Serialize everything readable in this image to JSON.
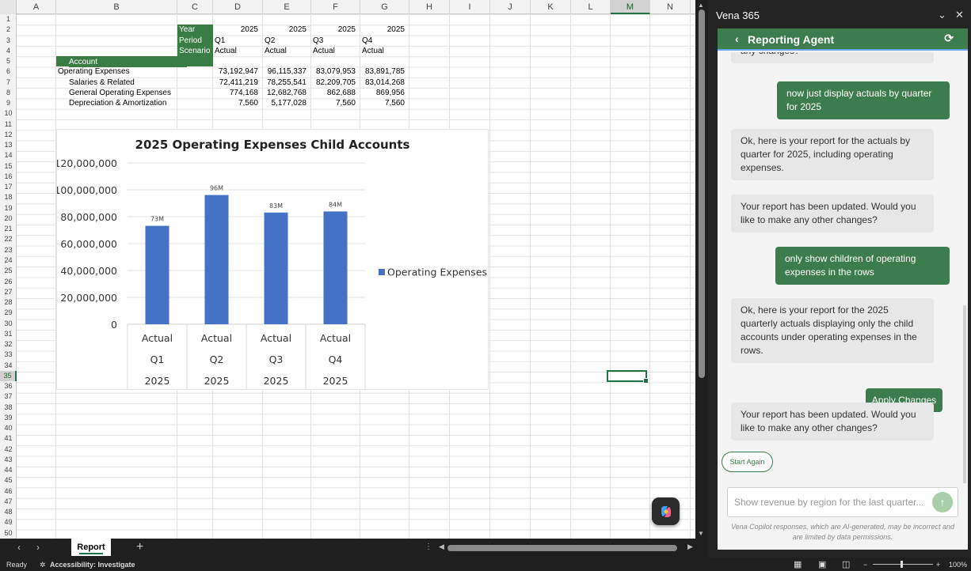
{
  "sheet": {
    "columns": [
      "A",
      "B",
      "C",
      "D",
      "E",
      "F",
      "G",
      "H",
      "I",
      "J",
      "K",
      "L",
      "M",
      "N"
    ],
    "selected_column": "M",
    "rows": [
      "1",
      "2",
      "3",
      "4",
      "5",
      "6",
      "7",
      "8",
      "9",
      "10",
      "11",
      "12",
      "13",
      "14",
      "15",
      "16",
      "17",
      "18",
      "19",
      "20",
      "21",
      "22",
      "23",
      "24",
      "25",
      "26",
      "27",
      "28",
      "29",
      "30",
      "31",
      "32",
      "33",
      "34",
      "35",
      "36",
      "37",
      "38",
      "39",
      "40",
      "41",
      "42",
      "43",
      "44",
      "45",
      "46",
      "47",
      "48",
      "49",
      "50"
    ],
    "selected_row": "35",
    "header": {
      "year_label": "Year",
      "period_label": "Period",
      "scenario_label": "Scenario",
      "account_label": "Account",
      "years": [
        "2025",
        "2025",
        "2025",
        "2025"
      ],
      "periods": [
        "Q1",
        "Q2",
        "Q3",
        "Q4"
      ],
      "scenarios": [
        "Actual",
        "Actual",
        "Actual",
        "Actual"
      ]
    },
    "accounts": [
      {
        "name": "Operating Expenses",
        "values": [
          "73,192,947",
          "96,115,337",
          "83,079,953",
          "83,891,785"
        ]
      },
      {
        "name": "Salaries & Related",
        "values": [
          "72,411,219",
          "78,255,541",
          "82,209,705",
          "83,014,268"
        ]
      },
      {
        "name": "General Operating Expenses",
        "values": [
          "774,168",
          "12,682,768",
          "862,688",
          "869,956"
        ]
      },
      {
        "name": "Depreciation & Amortization",
        "values": [
          "7,560",
          "5,177,028",
          "7,560",
          "7,560"
        ]
      }
    ],
    "tab_name": "Report",
    "add_sheet": "+"
  },
  "chart_data": {
    "type": "bar",
    "title": "2025 Operating Expenses Child Accounts",
    "categories": [
      [
        "Actual",
        "Q1",
        "2025"
      ],
      [
        "Actual",
        "Q2",
        "2025"
      ],
      [
        "Actual",
        "Q3",
        "2025"
      ],
      [
        "Actual",
        "Q4",
        "2025"
      ]
    ],
    "series": [
      {
        "name": "Operating Expenses",
        "values": [
          73192947,
          96115337,
          83079953,
          83891785
        ],
        "color": "#4472c4"
      }
    ],
    "data_labels": [
      "73M",
      "96M",
      "83M",
      "84M"
    ],
    "y_ticks": [
      "0",
      "20,000,000",
      "40,000,000",
      "60,000,000",
      "80,000,000",
      "100,000,000",
      "120,000,000"
    ],
    "ylim": [
      0,
      120000000
    ],
    "legend": "right",
    "grid": true
  },
  "status": {
    "ready": "Ready",
    "accessibility": "Accessibility: Investigate",
    "zoom": "100%"
  },
  "panel": {
    "app_title": "Vena 365",
    "agent_title": "Reporting Agent",
    "messages": [
      {
        "role": "bot",
        "text": "any changes?"
      },
      {
        "role": "user",
        "text": "now just display actuals by quarter for 2025"
      },
      {
        "role": "bot",
        "text": "Ok, here is your report for the actuals by quarter for 2025, including operating expenses."
      },
      {
        "role": "bot",
        "text": "Your report has been updated. Would you like to make any other changes?"
      },
      {
        "role": "user",
        "text": "only show children of operating expenses in the rows"
      },
      {
        "role": "bot",
        "text": "Ok, here is your report for the 2025 quarterly actuals displaying only the child accounts under operating expenses in the rows."
      },
      {
        "role": "bot",
        "text": "Your report has been updated. Would you like to make any other changes?"
      }
    ],
    "apply_label": "Apply Changes",
    "start_again_label": "Start Again",
    "input_placeholder": "Show revenue by region for the last quarter...",
    "disclaimer": "Vena Copilot responses, which are AI-generated, may be incorrect and are limited by data permissions."
  }
}
